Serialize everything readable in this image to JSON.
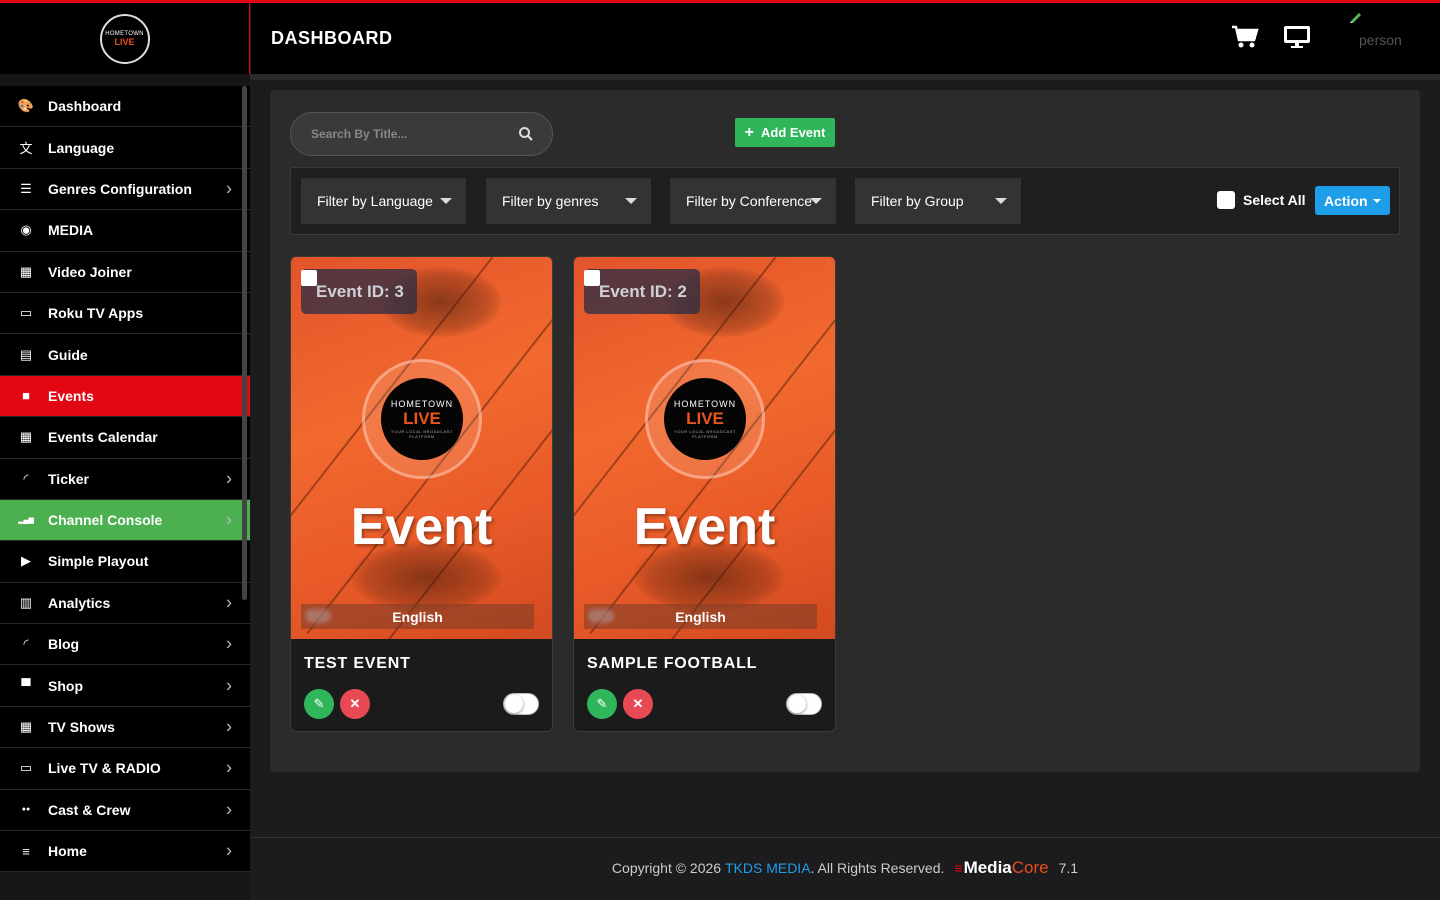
{
  "header": {
    "title": "DASHBOARD",
    "user_label": "person"
  },
  "logo": {
    "line1": "HOMETOWN",
    "line2": "LIVE",
    "line3": "YOUR LOCAL BROADCAST PLATFORM"
  },
  "sidebar": {
    "items": [
      {
        "label": "Dashboard",
        "icon": "palette-icon",
        "chevron": false
      },
      {
        "label": "Language",
        "icon": "language-icon",
        "chevron": false
      },
      {
        "label": "Genres Configuration",
        "icon": "list-icon",
        "chevron": true
      },
      {
        "label": "MEDIA",
        "icon": "camera-icon",
        "chevron": false
      },
      {
        "label": "Video Joiner",
        "icon": "film-icon",
        "chevron": false
      },
      {
        "label": "Roku TV Apps",
        "icon": "monitor-icon",
        "chevron": false
      },
      {
        "label": "Guide",
        "icon": "book-icon",
        "chevron": false
      },
      {
        "label": "Events",
        "icon": "video-camera-icon",
        "chevron": false,
        "active": true
      },
      {
        "label": "Events Calendar",
        "icon": "calendar-icon",
        "chevron": false
      },
      {
        "label": "Ticker",
        "icon": "rss-icon",
        "chevron": true
      },
      {
        "label": "Channel Console",
        "icon": "signal-icon",
        "chevron": true,
        "highlight": true
      },
      {
        "label": "Simple Playout",
        "icon": "play-circle-icon",
        "chevron": false
      },
      {
        "label": "Analytics",
        "icon": "bar-chart-icon",
        "chevron": true
      },
      {
        "label": "Blog",
        "icon": "rss-icon",
        "chevron": true
      },
      {
        "label": "Shop",
        "icon": "cart-icon",
        "chevron": true
      },
      {
        "label": "TV Shows",
        "icon": "film-icon",
        "chevron": true
      },
      {
        "label": "Live TV & RADIO",
        "icon": "monitor-icon",
        "chevron": true
      },
      {
        "label": "Cast & Crew",
        "icon": "users-icon",
        "chevron": true
      },
      {
        "label": "Home",
        "icon": "sliders-icon",
        "chevron": true
      }
    ]
  },
  "toolbar": {
    "search_placeholder": "Search By Title...",
    "add_event_label": "Add Event"
  },
  "filters": {
    "language": "Filter by Language",
    "genres": "Filter by genres",
    "conference": "Filter by Conference",
    "group": "Filter by Group",
    "select_all": "Select All",
    "action": "Action"
  },
  "events": [
    {
      "id_label": "Event ID: 3",
      "poster_word": "Event",
      "language": "English",
      "title": "TEST EVENT",
      "enabled": false
    },
    {
      "id_label": "Event ID: 2",
      "poster_word": "Event",
      "language": "English",
      "title": "SAMPLE FOOTBALL",
      "enabled": false
    }
  ],
  "footer": {
    "copyright": "Copyright © 2026",
    "company": "TKDS MEDIA",
    "rights": ". All Rights Reserved.",
    "brand_media": "Media",
    "brand_core": "Core",
    "version": "7.1"
  },
  "colors": {
    "accent_red": "#e30613",
    "accent_green": "#2fb65a",
    "accent_blue": "#1e9ee8",
    "poster_orange": "#f2692f"
  }
}
